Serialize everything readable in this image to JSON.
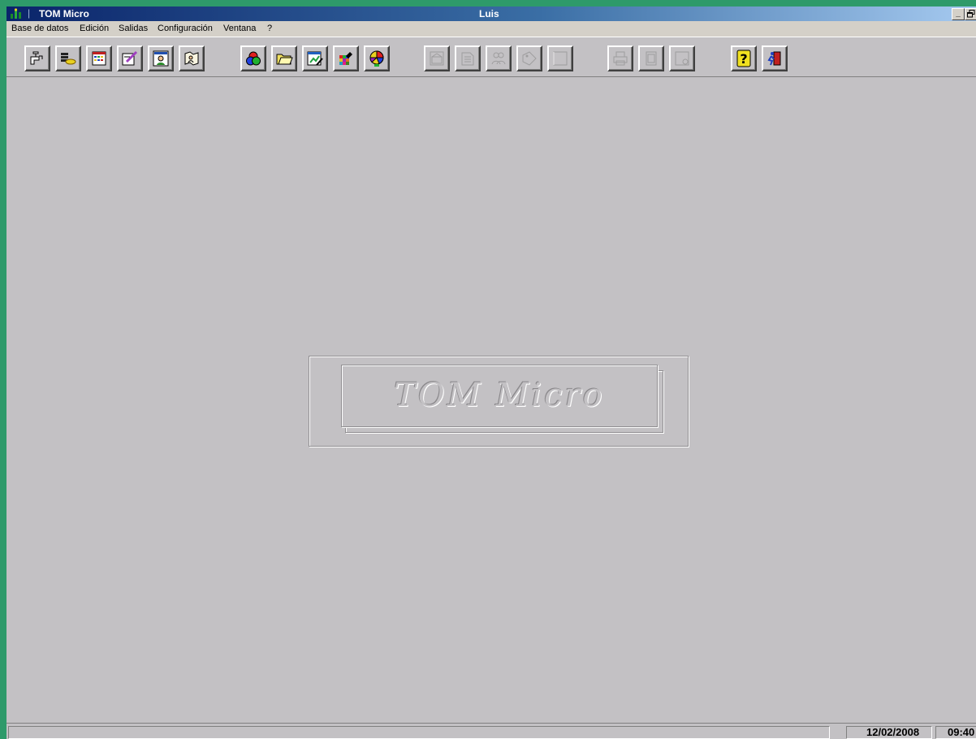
{
  "window": {
    "app_title": "TOM Micro",
    "document_title": "Luis",
    "controls": {
      "minimize": "_",
      "restore": "🗗"
    }
  },
  "menu": [
    "Base de datos",
    "Edición",
    "Salidas",
    "Configuración",
    "Ventana",
    "?"
  ],
  "toolbar": {
    "groups": [
      {
        "name": "database",
        "buttons": [
          "faucet-icon",
          "coins-icon",
          "calendar-icon",
          "pencil-edit-icon",
          "people-card-icon",
          "map-people-icon"
        ]
      },
      {
        "name": "analysis",
        "buttons": [
          "color-circles-icon",
          "folder-icon",
          "chart-edit-icon",
          "color-grid-icon",
          "pie-chart-icon"
        ]
      },
      {
        "name": "output",
        "buttons": [
          "building-icon",
          "pages-icon",
          "people-icon",
          "tag-icon",
          "frame-icon"
        ],
        "disabled": true
      },
      {
        "name": "print",
        "buttons": [
          "printer-icon",
          "page-icon",
          "preview-icon"
        ],
        "disabled": true
      },
      {
        "name": "help",
        "buttons": [
          "help-icon",
          "exit-icon"
        ]
      }
    ]
  },
  "logo": {
    "text": "TOM Micro"
  },
  "statusbar": {
    "message": "",
    "date": "12/02/2008",
    "time": "09:40"
  },
  "colors": {
    "desktop": "#2e9a6a",
    "workspace": "#c3c1c4",
    "titlebar_start": "#0a246a",
    "titlebar_end": "#a6caf0"
  }
}
